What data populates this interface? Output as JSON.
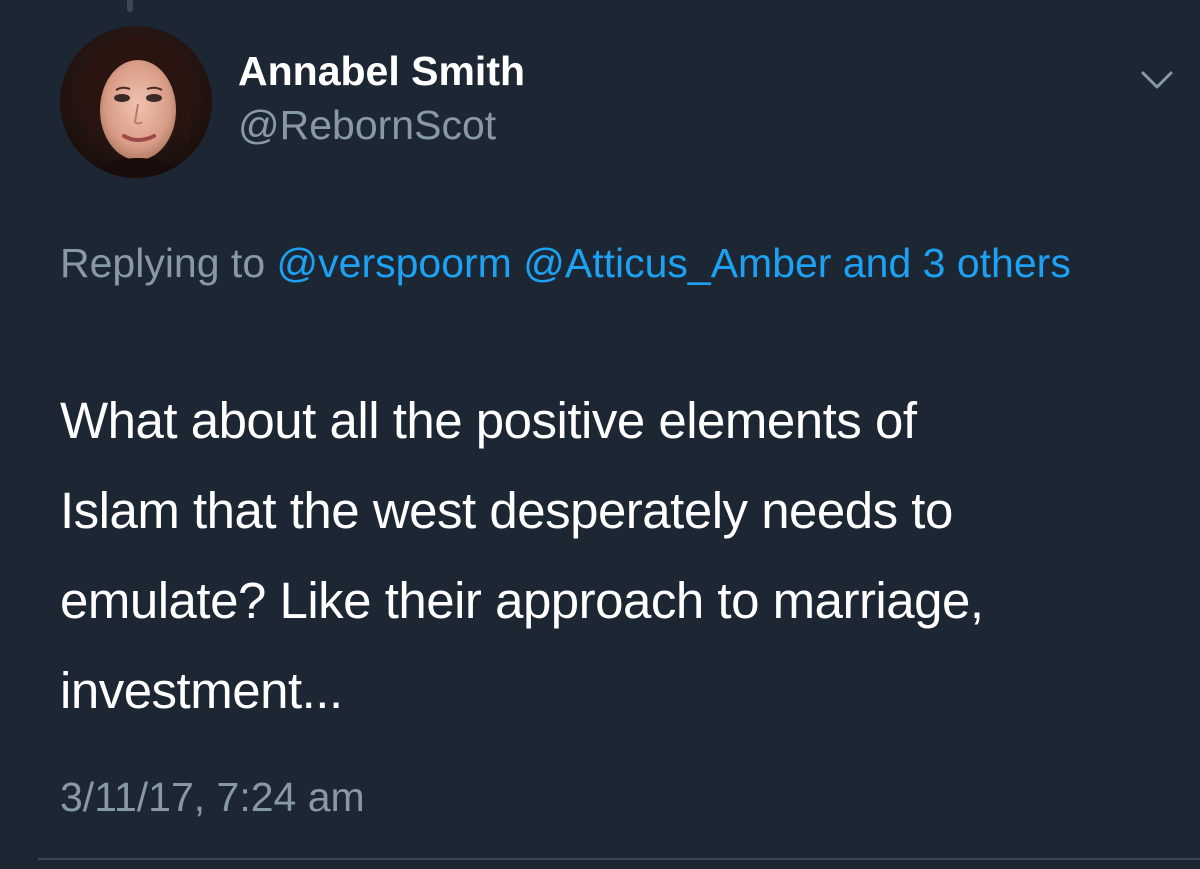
{
  "author": {
    "display_name": "Annabel Smith",
    "handle": "@RebornScot"
  },
  "reply": {
    "prefix": "Replying to",
    "mention1": "@verspoorm",
    "mention2": "@Atticus_Amber",
    "others": "and 3 others"
  },
  "tweet": {
    "lines": [
      "What about all the positive elements of",
      "Islam that the west desperately needs to",
      "emulate? Like their approach to marriage,",
      "investment..."
    ]
  },
  "timestamp": "3/11/17, 7:24 am",
  "icons": {
    "menu": "chevron-down-icon",
    "avatar": "profile-photo"
  },
  "colors": {
    "background": "#1c2733",
    "text": "#ffffff",
    "secondary": "#8899a6",
    "link": "#1da1f2",
    "divider": "#3a4754"
  }
}
